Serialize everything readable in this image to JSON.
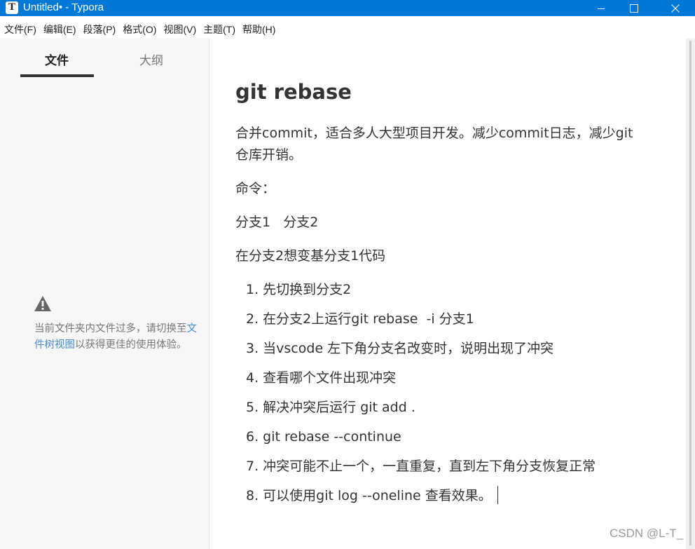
{
  "window": {
    "app_icon_letter": "T",
    "title": "Untitled• - Typora"
  },
  "menu": [
    "文件(F)",
    "编辑(E)",
    "段落(P)",
    "格式(O)",
    "视图(V)",
    "主题(T)",
    "帮助(H)"
  ],
  "sidebar": {
    "tab_files": "文件",
    "tab_outline": "大纲",
    "warning_prefix": "当前文件夹内文件过多，请切换至",
    "warning_link": "文件树视图",
    "warning_suffix": "以获得更佳的使用体验。"
  },
  "document": {
    "title": "git rebase",
    "para1_line1": "合并commit，适合多人大型项目开发。减少commit日志，减少git",
    "para1_line2": "仓库开销。",
    "para2": "命令：",
    "para3": "分支1   分支2",
    "para4": "在分支2想变基分支1代码",
    "steps": [
      "1. 先切换到分支2",
      "2. 在分支2上运行git rebase  -i 分支1",
      "3. 当vscode 左下角分支名改变时，说明出现了冲突",
      "4. 查看哪个文件出现冲突",
      "5. 解决冲突后运行 git add .",
      "6. git rebase --continue",
      "7. 冲突可能不止一个，一直重复，直到左下角分支恢复正常",
      "8. 可以使用git log --oneline 查看效果。"
    ]
  },
  "watermark": "CSDN @L-T_"
}
